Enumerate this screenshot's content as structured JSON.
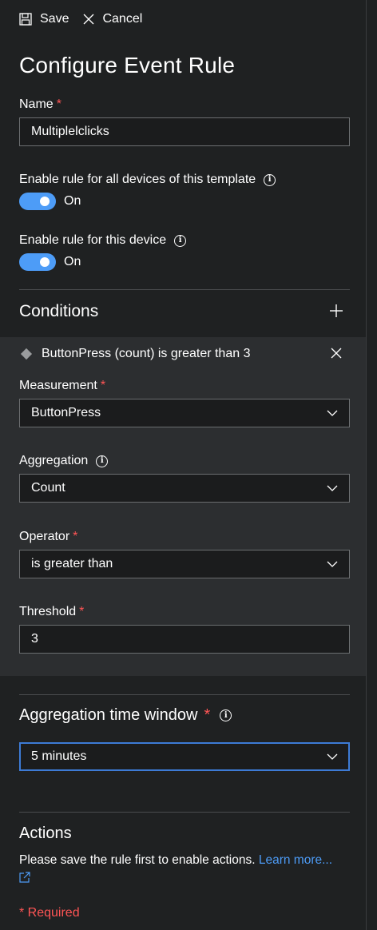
{
  "toolbar": {
    "save_label": "Save",
    "cancel_label": "Cancel"
  },
  "page": {
    "title": "Configure Event Rule"
  },
  "name_field": {
    "label": "Name",
    "required_mark": "*",
    "value": "Multiplelclicks"
  },
  "toggle_template": {
    "label": "Enable rule for all devices of this template",
    "state_label": "On",
    "on": true
  },
  "toggle_device": {
    "label": "Enable rule for this device",
    "state_label": "On",
    "on": true
  },
  "conditions": {
    "title": "Conditions",
    "items": [
      {
        "summary": "ButtonPress (count) is greater than 3",
        "measurement": {
          "label": "Measurement",
          "required_mark": "*",
          "value": "ButtonPress"
        },
        "aggregation": {
          "label": "Aggregation",
          "value": "Count"
        },
        "operator": {
          "label": "Operator",
          "required_mark": "*",
          "value": "is greater than"
        },
        "threshold": {
          "label": "Threshold",
          "required_mark": "*",
          "value": "3"
        }
      }
    ]
  },
  "time_window": {
    "label": "Aggregation time window",
    "required_mark": "*",
    "value": "5 minutes"
  },
  "actions": {
    "title": "Actions",
    "message": "Please save the rule first to enable actions.",
    "link_label": "Learn more..."
  },
  "footer": {
    "required_note": "* Required"
  },
  "colors": {
    "background": "#1f2122",
    "condition_panel": "#2c2e30",
    "accent": "#4d9cf7",
    "required": "#ff5555",
    "focus_border": "#3d7bd6"
  },
  "icons": [
    "save-icon",
    "cancel-icon",
    "info-icon",
    "plus-icon",
    "close-icon",
    "diamond-icon",
    "chevron-down-icon",
    "external-link-icon"
  ]
}
